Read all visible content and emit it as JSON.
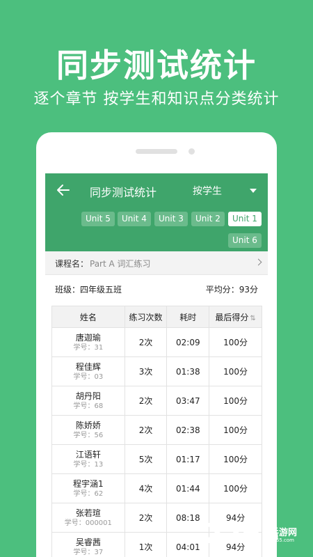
{
  "promo": {
    "headline": "同步测试统计",
    "subline": "逐个章节  按学生和知识点分类统计"
  },
  "appbar": {
    "title": "同步测试统计",
    "mode": "按学生",
    "units": [
      "Unit 5",
      "Unit 4",
      "Unit 3",
      "Unit 2",
      "Unit 1",
      "Unit 6"
    ],
    "active_unit": "Unit 1"
  },
  "course": {
    "label": "课程名：",
    "value": "Part A 词汇练习"
  },
  "summary": {
    "class": "班级：四年级五班",
    "average": "平均分：93分"
  },
  "table": {
    "headers": [
      "姓名",
      "练习次数",
      "耗时",
      "最后得分"
    ],
    "rows": [
      {
        "name": "唐迦瑜",
        "id": "学号：31",
        "count": "2次",
        "time": "02:09",
        "score": "100分"
      },
      {
        "name": "程佳辉",
        "id": "学号：03",
        "count": "3次",
        "time": "01:38",
        "score": "100分"
      },
      {
        "name": "胡丹阳",
        "id": "学号：68",
        "count": "2次",
        "time": "03:47",
        "score": "100分"
      },
      {
        "name": "陈娇娇",
        "id": "学号：56",
        "count": "2次",
        "time": "02:38",
        "score": "100分"
      },
      {
        "name": "江语轩",
        "id": "学号：13",
        "count": "5次",
        "time": "01:17",
        "score": "100分"
      },
      {
        "name": "程宇涵1",
        "id": "学号：62",
        "count": "4次",
        "time": "01:44",
        "score": "100分"
      },
      {
        "name": "张若瑄",
        "id": "学号：000001",
        "count": "2次",
        "time": "08:18",
        "score": "94分"
      },
      {
        "name": "吴睿茜",
        "id": "学号：37",
        "count": "1次",
        "time": "04:01",
        "score": "94分"
      }
    ]
  },
  "watermark": {
    "number": "2265",
    "text": "手游网",
    "url": "2265.com"
  },
  "colors": {
    "background": "#4cbf7e",
    "appbar": "#3fa56b",
    "chip": "#6bbb8c"
  }
}
